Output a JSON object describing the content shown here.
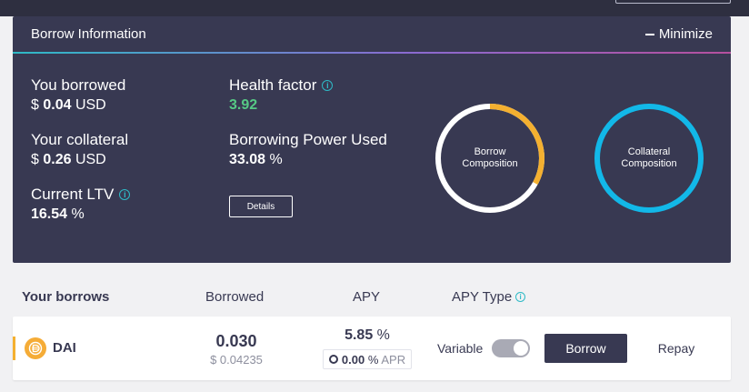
{
  "panel": {
    "title": "Borrow Information",
    "minimize_label": "Minimize"
  },
  "stats": {
    "you_borrowed": {
      "label": "You borrowed",
      "prefix": "$",
      "value": "0.04",
      "unit": "USD"
    },
    "your_collateral": {
      "label": "Your collateral",
      "prefix": "$",
      "value": "0.26",
      "unit": "USD"
    },
    "current_ltv": {
      "label": "Current LTV",
      "value": "16.54",
      "unit": "%"
    },
    "health_factor": {
      "label": "Health factor",
      "value": "3.92"
    },
    "borrowing_power_used": {
      "label": "Borrowing Power Used",
      "value": "33.08",
      "unit": "%"
    }
  },
  "details_button": "Details",
  "donuts": {
    "borrow_composition": {
      "line1": "Borrow",
      "line2": "Composition",
      "fraction": 0.33,
      "color": "#f4b030",
      "rest_color": "#ffffff"
    },
    "collateral_composition": {
      "line1": "Collateral",
      "line2": "Composition",
      "fraction": 1.0,
      "color": "#12b8e8"
    }
  },
  "table": {
    "headers": {
      "your_borrows": "Your borrows",
      "borrowed": "Borrowed",
      "apy": "APY",
      "apy_type": "APY Type"
    },
    "rows": [
      {
        "asset": "DAI",
        "borrowed": "0.030",
        "borrowed_usd": "$ 0.04235",
        "apy": "5.85",
        "apy_unit": "%",
        "apr": "0.00",
        "apr_unit": "%",
        "apr_label": "APR",
        "apy_type": "Variable",
        "borrow_label": "Borrow",
        "repay_label": "Repay"
      }
    ]
  },
  "colors": {
    "panel_bg": "#383952",
    "health_green": "#56c985",
    "accent_teal": "#2ebac6",
    "dai_gold": "#f5ac37"
  },
  "icons": [
    "info-icon",
    "minimize-icon",
    "dai-token-icon",
    "apr-incentive-icon"
  ]
}
